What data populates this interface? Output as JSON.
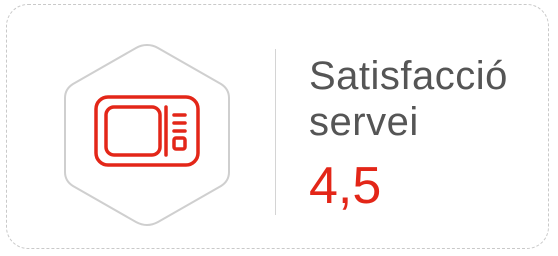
{
  "metric": {
    "label_line1": "Satisfacció",
    "label_line2": "servei",
    "value": "4,5",
    "icon": "microwave-icon"
  },
  "colors": {
    "accent": "#e32618",
    "label": "#555555",
    "hex_border": "#cfcfcf",
    "card_border": "#c9c9c9"
  }
}
